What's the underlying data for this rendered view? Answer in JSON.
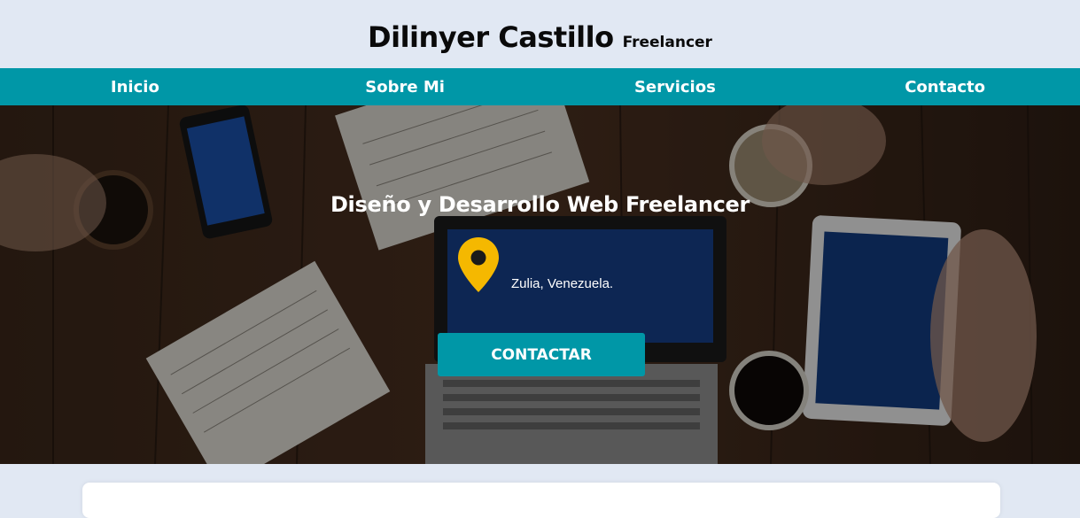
{
  "header": {
    "name": "Dilinyer Castillo",
    "tagline": "Freelancer"
  },
  "nav": {
    "items": [
      {
        "label": "Inicio"
      },
      {
        "label": "Sobre Mi"
      },
      {
        "label": "Servicios"
      },
      {
        "label": "Contacto"
      }
    ]
  },
  "hero": {
    "title": "Diseño y Desarrollo Web Freelancer",
    "location": "Zulia, Venezuela.",
    "location_icon": "map-pin-icon",
    "cta_label": "CONTACTAR"
  },
  "colors": {
    "accent": "#0097a7",
    "background": "#e1e8f3",
    "pin": "#f5b800"
  }
}
